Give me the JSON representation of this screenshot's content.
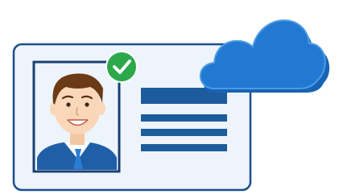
{
  "illustration": {
    "subject": "",
    "colors": {
      "card_fill": "#EEF4FB",
      "card_border": "#1B4E8C",
      "photo_frame": "#1B3F73",
      "text_lines": "#1D5C9C",
      "check_badge": "#2BA84A",
      "check_mark": "#FFFFFF",
      "cloud_back": "#1763B4",
      "cloud_front": "#2279D2",
      "cloud_outline": "#4E9BE6",
      "hair": "#6B3A16",
      "skin": "#FAD7B8",
      "shirt": "#FFFFFF",
      "jacket": "#1E5FA8",
      "tie": "#2B7CD3"
    },
    "icons": [
      "id-card-icon",
      "check-badge-icon",
      "cloud-icon",
      "person-avatar-icon"
    ]
  }
}
